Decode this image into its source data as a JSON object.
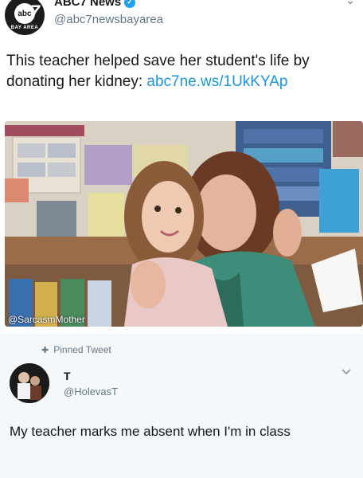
{
  "tweet": {
    "account_name": "ABC7 News",
    "handle": "@abc7newsbayarea",
    "avatar_brand": "abc",
    "avatar_number": "7",
    "avatar_subtitle": "BAY AREA",
    "text": "This teacher helped save her student's life by donating her kidney: ",
    "link": "abc7ne.ws/1UkKYAp",
    "photo_watermark": "@SarcasmMother"
  },
  "reply": {
    "pinned_label": "Pinned Tweet",
    "name": "T",
    "handle": "@HolevasT",
    "text": "My teacher marks me absent when I'm in class"
  },
  "colors": {
    "link": "#1b95e0",
    "verified": "#1da1f2",
    "secondary_text": "#657786",
    "card_background": "#f5f8fa"
  },
  "icons": {
    "verified": "verified-badge-icon",
    "pin": "pin-icon",
    "menu": "chevron-down-icon"
  }
}
